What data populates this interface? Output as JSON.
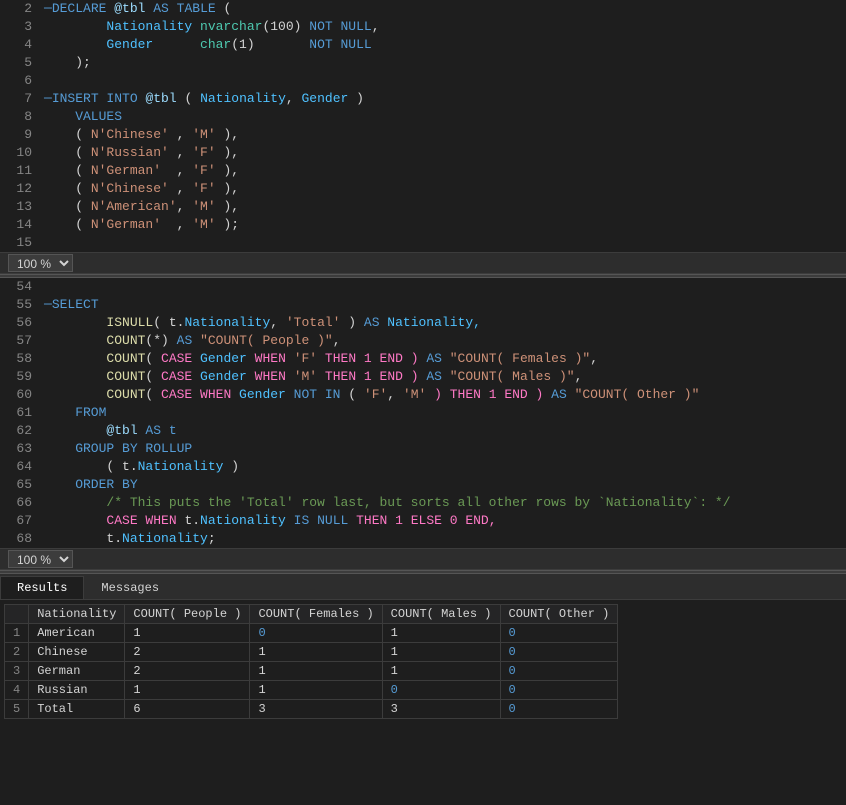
{
  "zoom1": "100 %",
  "zoom2": "100 %",
  "tabs": {
    "results": "Results",
    "messages": "Messages"
  },
  "code_upper": {
    "lines": [
      {
        "num": 2,
        "parts": [
          {
            "t": "─",
            "c": "minus-fold"
          },
          {
            "t": "DECLARE ",
            "c": "kw-blue"
          },
          {
            "t": "@tbl",
            "c": "at-var"
          },
          {
            "t": " AS ",
            "c": "kw-blue"
          },
          {
            "t": "TABLE",
            "c": "kw-blue"
          },
          {
            "t": " (",
            "c": "plain"
          }
        ]
      },
      {
        "num": 3,
        "parts": [
          {
            "t": "        Nationality ",
            "c": "col-color"
          },
          {
            "t": "nvarchar",
            "c": "type-green"
          },
          {
            "t": "(100) ",
            "c": "plain"
          },
          {
            "t": "NOT NULL",
            "c": "kw-blue"
          },
          {
            "t": ",",
            "c": "plain"
          }
        ]
      },
      {
        "num": 4,
        "parts": [
          {
            "t": "        Gender      ",
            "c": "col-color"
          },
          {
            "t": "char",
            "c": "type-green"
          },
          {
            "t": "(1)       ",
            "c": "plain"
          },
          {
            "t": "NOT NULL",
            "c": "kw-blue"
          }
        ]
      },
      {
        "num": 5,
        "parts": [
          {
            "t": "    );",
            "c": "plain"
          }
        ]
      },
      {
        "num": 6,
        "parts": [
          {
            "t": "",
            "c": "plain"
          }
        ]
      },
      {
        "num": 7,
        "parts": [
          {
            "t": "─",
            "c": "minus-fold"
          },
          {
            "t": "INSERT INTO ",
            "c": "kw-blue"
          },
          {
            "t": "@tbl",
            "c": "at-var"
          },
          {
            "t": " ( ",
            "c": "plain"
          },
          {
            "t": "Nationality",
            "c": "col-color"
          },
          {
            "t": ", ",
            "c": "plain"
          },
          {
            "t": "Gender",
            "c": "col-color"
          },
          {
            "t": " )",
            "c": "plain"
          }
        ]
      },
      {
        "num": 8,
        "parts": [
          {
            "t": "    VALUES",
            "c": "kw-blue"
          }
        ]
      },
      {
        "num": 9,
        "parts": [
          {
            "t": "    ( ",
            "c": "plain"
          },
          {
            "t": "N'Chinese'",
            "c": "str-orange"
          },
          {
            "t": " , ",
            "c": "plain"
          },
          {
            "t": "'M'",
            "c": "str-orange"
          },
          {
            "t": " ),",
            "c": "plain"
          }
        ]
      },
      {
        "num": 10,
        "parts": [
          {
            "t": "    ( ",
            "c": "plain"
          },
          {
            "t": "N'Russian'",
            "c": "str-orange"
          },
          {
            "t": " , ",
            "c": "plain"
          },
          {
            "t": "'F'",
            "c": "str-orange"
          },
          {
            "t": " ),",
            "c": "plain"
          }
        ]
      },
      {
        "num": 11,
        "parts": [
          {
            "t": "    ( ",
            "c": "plain"
          },
          {
            "t": "N'German' ",
            "c": "str-orange"
          },
          {
            "t": " , ",
            "c": "plain"
          },
          {
            "t": "'F'",
            "c": "str-orange"
          },
          {
            "t": " ),",
            "c": "plain"
          }
        ]
      },
      {
        "num": 12,
        "parts": [
          {
            "t": "    ( ",
            "c": "plain"
          },
          {
            "t": "N'Chinese'",
            "c": "str-orange"
          },
          {
            "t": " , ",
            "c": "plain"
          },
          {
            "t": "'F'",
            "c": "str-orange"
          },
          {
            "t": " ),",
            "c": "plain"
          }
        ]
      },
      {
        "num": 13,
        "parts": [
          {
            "t": "    ( ",
            "c": "plain"
          },
          {
            "t": "N'American'",
            "c": "str-orange"
          },
          {
            "t": ", ",
            "c": "plain"
          },
          {
            "t": "'M'",
            "c": "str-orange"
          },
          {
            "t": " ),",
            "c": "plain"
          }
        ]
      },
      {
        "num": 14,
        "parts": [
          {
            "t": "    ( ",
            "c": "plain"
          },
          {
            "t": "N'German' ",
            "c": "str-orange"
          },
          {
            "t": " , ",
            "c": "plain"
          },
          {
            "t": "'M'",
            "c": "str-orange"
          },
          {
            "t": " );",
            "c": "plain"
          }
        ]
      },
      {
        "num": 15,
        "parts": [
          {
            "t": "",
            "c": "plain"
          }
        ]
      }
    ]
  },
  "code_lower": {
    "lines": [
      {
        "num": 54,
        "parts": [
          {
            "t": "",
            "c": "plain"
          }
        ]
      },
      {
        "num": 55,
        "parts": [
          {
            "t": "─",
            "c": "minus-fold"
          },
          {
            "t": "SELECT",
            "c": "kw-blue"
          }
        ]
      },
      {
        "num": 56,
        "parts": [
          {
            "t": "        ISNULL",
            "c": "func-yellow"
          },
          {
            "t": "( t.",
            "c": "plain"
          },
          {
            "t": "Nationality",
            "c": "col-color"
          },
          {
            "t": ", ",
            "c": "plain"
          },
          {
            "t": "'Total'",
            "c": "str-orange"
          },
          {
            "t": " ) ",
            "c": "plain"
          },
          {
            "t": "AS",
            "c": "kw-blue"
          },
          {
            "t": " Nationality,",
            "c": "col-color"
          }
        ]
      },
      {
        "num": 57,
        "parts": [
          {
            "t": "        COUNT",
            "c": "func-yellow"
          },
          {
            "t": "(*) ",
            "c": "plain"
          },
          {
            "t": "AS",
            "c": "kw-blue"
          },
          {
            "t": " ",
            "c": "plain"
          },
          {
            "t": "\"COUNT( People )\"",
            "c": "str-orange"
          },
          {
            "t": ",",
            "c": "plain"
          }
        ]
      },
      {
        "num": 58,
        "parts": [
          {
            "t": "        COUNT",
            "c": "func-yellow"
          },
          {
            "t": "( ",
            "c": "plain"
          },
          {
            "t": "CASE",
            "c": "kw-case"
          },
          {
            "t": " Gender ",
            "c": "col-color"
          },
          {
            "t": "WHEN",
            "c": "kw-case"
          },
          {
            "t": " ",
            "c": "plain"
          },
          {
            "t": "'F'",
            "c": "str-orange"
          },
          {
            "t": " THEN 1 END ) ",
            "c": "kw-case"
          },
          {
            "t": "AS",
            "c": "kw-blue"
          },
          {
            "t": " ",
            "c": "plain"
          },
          {
            "t": "\"COUNT( Females )\"",
            "c": "str-orange"
          },
          {
            "t": ",",
            "c": "plain"
          }
        ]
      },
      {
        "num": 59,
        "parts": [
          {
            "t": "        COUNT",
            "c": "func-yellow"
          },
          {
            "t": "( ",
            "c": "plain"
          },
          {
            "t": "CASE",
            "c": "kw-case"
          },
          {
            "t": " Gender ",
            "c": "col-color"
          },
          {
            "t": "WHEN",
            "c": "kw-case"
          },
          {
            "t": " ",
            "c": "plain"
          },
          {
            "t": "'M'",
            "c": "str-orange"
          },
          {
            "t": " THEN 1 END ) ",
            "c": "kw-case"
          },
          {
            "t": "AS",
            "c": "kw-blue"
          },
          {
            "t": " ",
            "c": "plain"
          },
          {
            "t": "\"COUNT( Males )\"",
            "c": "str-orange"
          },
          {
            "t": ",",
            "c": "plain"
          }
        ]
      },
      {
        "num": 60,
        "parts": [
          {
            "t": "        COUNT",
            "c": "func-yellow"
          },
          {
            "t": "( ",
            "c": "plain"
          },
          {
            "t": "CASE WHEN",
            "c": "kw-case"
          },
          {
            "t": " Gender ",
            "c": "col-color"
          },
          {
            "t": "NOT IN",
            "c": "kw-blue"
          },
          {
            "t": " ( ",
            "c": "plain"
          },
          {
            "t": "'F'",
            "c": "str-orange"
          },
          {
            "t": ", ",
            "c": "plain"
          },
          {
            "t": "'M'",
            "c": "str-orange"
          },
          {
            "t": " ) THEN 1 END ) ",
            "c": "kw-case"
          },
          {
            "t": "AS",
            "c": "kw-blue"
          },
          {
            "t": " ",
            "c": "plain"
          },
          {
            "t": "\"COUNT( Other )\"",
            "c": "str-orange"
          }
        ]
      },
      {
        "num": 61,
        "parts": [
          {
            "t": "    FROM",
            "c": "kw-blue"
          }
        ]
      },
      {
        "num": 62,
        "parts": [
          {
            "t": "        @tbl",
            "c": "at-var"
          },
          {
            "t": " AS t",
            "c": "kw-blue"
          }
        ]
      },
      {
        "num": 63,
        "parts": [
          {
            "t": "    GROUP BY ROLLUP",
            "c": "kw-blue"
          }
        ]
      },
      {
        "num": 64,
        "parts": [
          {
            "t": "        ( t.",
            "c": "plain"
          },
          {
            "t": "Nationality",
            "c": "col-color"
          },
          {
            "t": " )",
            "c": "plain"
          }
        ]
      },
      {
        "num": 65,
        "parts": [
          {
            "t": "    ORDER BY",
            "c": "kw-blue"
          }
        ]
      },
      {
        "num": 66,
        "parts": [
          {
            "t": "        ",
            "c": "plain"
          },
          {
            "t": "/* This puts the 'Total' row last, but sorts all other rows by `Nationality`: */",
            "c": "comment-green"
          }
        ]
      },
      {
        "num": 67,
        "parts": [
          {
            "t": "        ",
            "c": "plain"
          },
          {
            "t": "CASE WHEN",
            "c": "kw-case"
          },
          {
            "t": " t.",
            "c": "plain"
          },
          {
            "t": "Nationality",
            "c": "col-color"
          },
          {
            "t": " IS ",
            "c": "kw-blue"
          },
          {
            "t": "NULL",
            "c": "kw-blue"
          },
          {
            "t": " THEN 1 ELSE 0 END,",
            "c": "kw-case"
          }
        ]
      },
      {
        "num": 68,
        "parts": [
          {
            "t": "        t.",
            "c": "plain"
          },
          {
            "t": "Nationality",
            "c": "col-color"
          },
          {
            "t": ";",
            "c": "plain"
          }
        ]
      }
    ]
  },
  "results": {
    "headers": [
      "Nationality",
      "COUNT( People )",
      "COUNT( Females )",
      "COUNT( Males )",
      "COUNT( Other )"
    ],
    "rows": [
      {
        "num": 1,
        "nationality": "American",
        "people": "1",
        "females": "0",
        "males": "1",
        "other": "0"
      },
      {
        "num": 2,
        "nationality": "Chinese",
        "people": "2",
        "females": "1",
        "males": "1",
        "other": "0"
      },
      {
        "num": 3,
        "nationality": "German",
        "people": "2",
        "females": "1",
        "males": "1",
        "other": "0"
      },
      {
        "num": 4,
        "nationality": "Russian",
        "people": "1",
        "females": "1",
        "males": "0",
        "other": "0"
      },
      {
        "num": 5,
        "nationality": "Total",
        "people": "6",
        "females": "3",
        "males": "3",
        "other": "0"
      }
    ]
  }
}
